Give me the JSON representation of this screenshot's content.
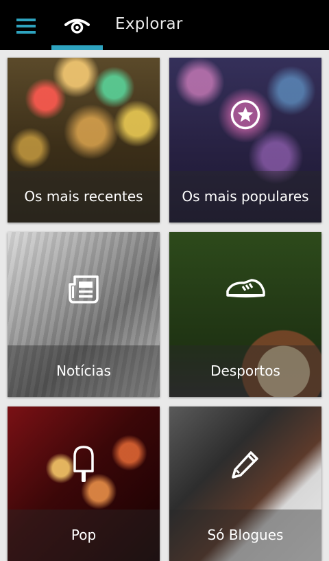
{
  "header": {
    "title": "Explorar",
    "menu_icon": "hamburger-menu-icon",
    "discover_icon": "eye-icon",
    "accent_color": "#2ea3bf"
  },
  "tiles": [
    {
      "label": "Os mais recentes",
      "icon": ""
    },
    {
      "label": "Os mais populares",
      "icon": "star-circle-icon"
    },
    {
      "label": "Notícias",
      "icon": "newspaper-icon"
    },
    {
      "label": "Desportos",
      "icon": "sneaker-icon"
    },
    {
      "label": "Pop",
      "icon": "popsicle-icon"
    },
    {
      "label": "Só Blogues",
      "icon": "pencil-icon"
    }
  ]
}
